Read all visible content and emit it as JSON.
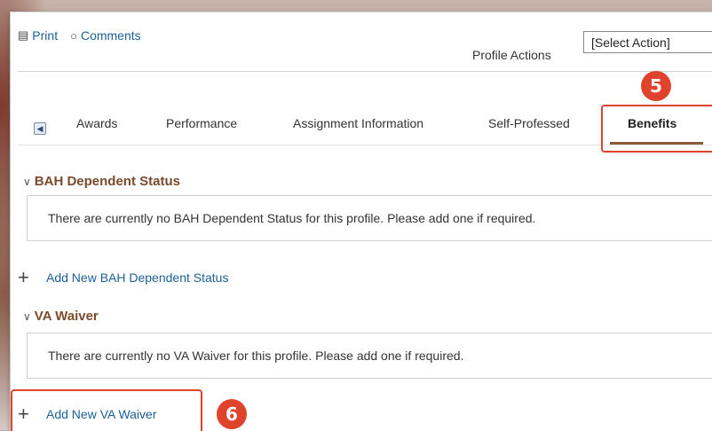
{
  "toolbar": {
    "print_label": "Print",
    "comments_label": "Comments"
  },
  "profile_actions": {
    "label": "Profile Actions",
    "selected": "[Select Action]"
  },
  "tabs": [
    {
      "label": "Awards"
    },
    {
      "label": "Performance"
    },
    {
      "label": "Assignment Information"
    },
    {
      "label": "Self-Professed"
    },
    {
      "label": "Benefits",
      "active": true
    }
  ],
  "callouts": {
    "step5": "5",
    "step6": "6"
  },
  "sections": {
    "bah": {
      "title": "BAH Dependent Status",
      "message": "There are currently no BAH Dependent Status for this profile.  Please add one if required.",
      "add_label": "Add New BAH Dependent Status"
    },
    "va": {
      "title": "VA Waiver",
      "message": "There are currently no VA Waiver for this profile.  Please add one if required.",
      "add_label": "Add New VA Waiver"
    }
  },
  "colors": {
    "accent": "#e0432b",
    "link": "#1b5f97",
    "section_title": "#7b4a2c"
  }
}
